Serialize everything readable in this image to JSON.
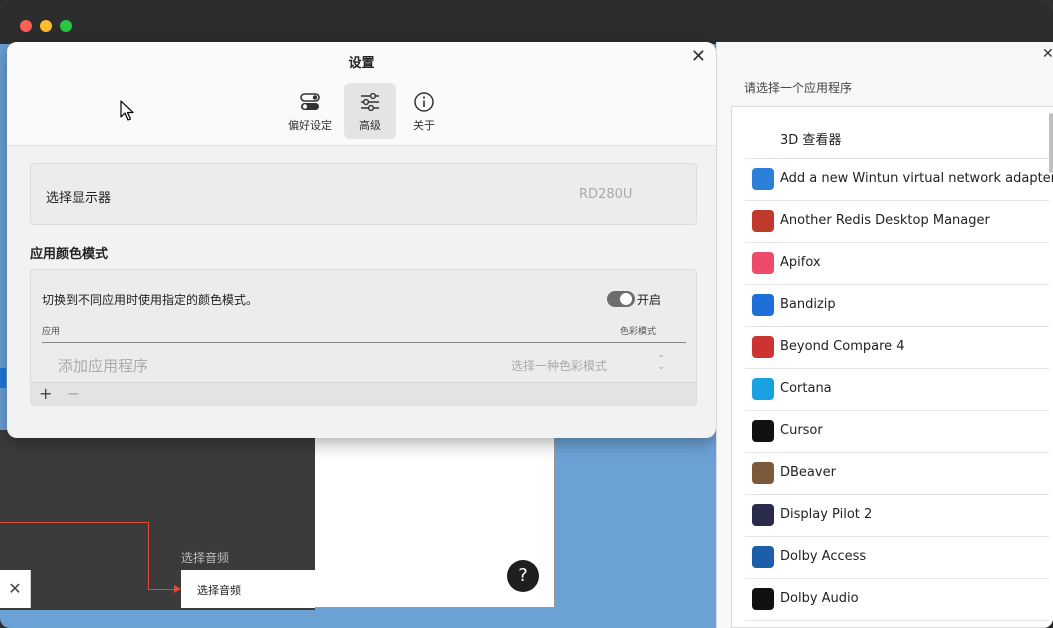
{
  "settings": {
    "title": "设置",
    "tabs": [
      {
        "label": "偏好设定",
        "icon": "toggles-icon"
      },
      {
        "label": "高级",
        "icon": "sliders-icon"
      },
      {
        "label": "关于",
        "icon": "info-icon"
      }
    ],
    "active_tab": "高级",
    "display": {
      "label": "选择显示器",
      "value": "RD280U"
    },
    "color_mode": {
      "section_title": "应用颜色模式",
      "description": "切换到不同应用时使用指定的颜色模式。",
      "toggle_label": "开启",
      "toggle_on": true,
      "column_app": "应用",
      "column_mode": "色彩模式",
      "add_app_placeholder": "添加应用程序",
      "pick_mode_placeholder": "选择一种色彩模式",
      "add_symbol": "+",
      "remove_symbol": "−"
    }
  },
  "picker": {
    "title": "请选择一个应用程序",
    "apps": [
      {
        "name": "3D 查看器",
        "icon_color": "#ffffff"
      },
      {
        "name": "Add a new Wintun virtual network adapter",
        "icon_color": "#2b7fd9"
      },
      {
        "name": "Another Redis Desktop Manager",
        "icon_color": "#c0392b"
      },
      {
        "name": "Apifox",
        "icon_color": "#ee4a6b"
      },
      {
        "name": "Bandizip",
        "icon_color": "#1f6fd8"
      },
      {
        "name": "Beyond Compare 4",
        "icon_color": "#cc3333"
      },
      {
        "name": "Cortana",
        "icon_color": "#1aa1e1"
      },
      {
        "name": "Cursor",
        "icon_color": "#111111"
      },
      {
        "name": "DBeaver",
        "icon_color": "#7a5a3a"
      },
      {
        "name": "Display Pilot 2",
        "icon_color": "#2a2a4a"
      },
      {
        "name": "Dolby Access",
        "icon_color": "#1b5fa8"
      },
      {
        "name": "Dolby Audio",
        "icon_color": "#111111"
      }
    ]
  },
  "background_app": {
    "section_label": "选择音频",
    "select_value": "选择音频",
    "help_symbol": "?",
    "close_symbol": "✕"
  },
  "window_close_symbol": "✕"
}
